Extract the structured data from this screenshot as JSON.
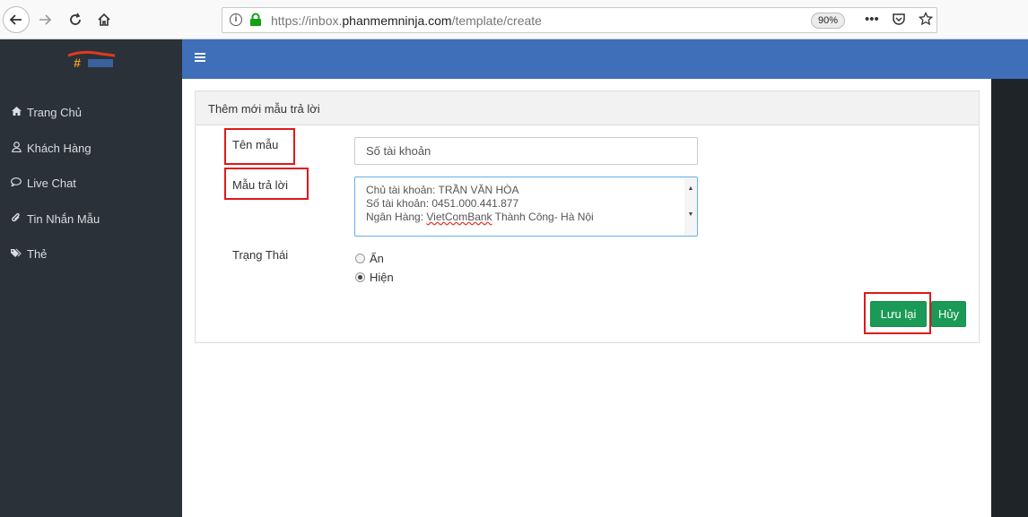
{
  "browser": {
    "url_prefix": "https://inbox.",
    "url_domain": "phanmemninja.com",
    "url_path": "/template/create",
    "zoom": "90%",
    "icons": [
      "back-arrow-icon",
      "forward-arrow-icon",
      "reload-icon",
      "home-icon",
      "info-icon",
      "lock-icon",
      "more-icon",
      "pocket-icon",
      "bookmark-star-icon"
    ]
  },
  "sidebar": {
    "items": [
      {
        "label": "Trang Chủ",
        "icon": "home-icon"
      },
      {
        "label": "Khách Hàng",
        "icon": "user-icon"
      },
      {
        "label": "Live Chat",
        "icon": "chat-icon"
      },
      {
        "label": "Tin Nhắn Mẫu",
        "icon": "paperclip-icon"
      },
      {
        "label": "Thẻ",
        "icon": "tags-icon"
      }
    ]
  },
  "panel": {
    "heading": "Thêm mới mẫu trả lời"
  },
  "form": {
    "name_label": "Tên mẫu",
    "name_value": "Số tài khoản",
    "template_label": "Mẫu trả lời",
    "template_lines": [
      "Chủ tài khoản: TRẦN VĂN HÒA",
      "Số tài khoản: 0451.000.441.877"
    ],
    "template_line3_prefix": "Ngân Hàng: ",
    "template_line3_spell": "VietComBank",
    "template_line3_suffix": " Thành Công- Hà Nội",
    "status_label": "Trạng Thái",
    "status_options": [
      "Ẩn",
      "Hiện"
    ],
    "status_selected": "Hiện",
    "save_label": "Lưu lại",
    "cancel_label": "Hủy"
  },
  "colors": {
    "sidebar_bg": "#2a3139",
    "topbar_bg": "#3e6fb8",
    "button_green": "#1a9a56",
    "highlight_red": "#e01919"
  }
}
